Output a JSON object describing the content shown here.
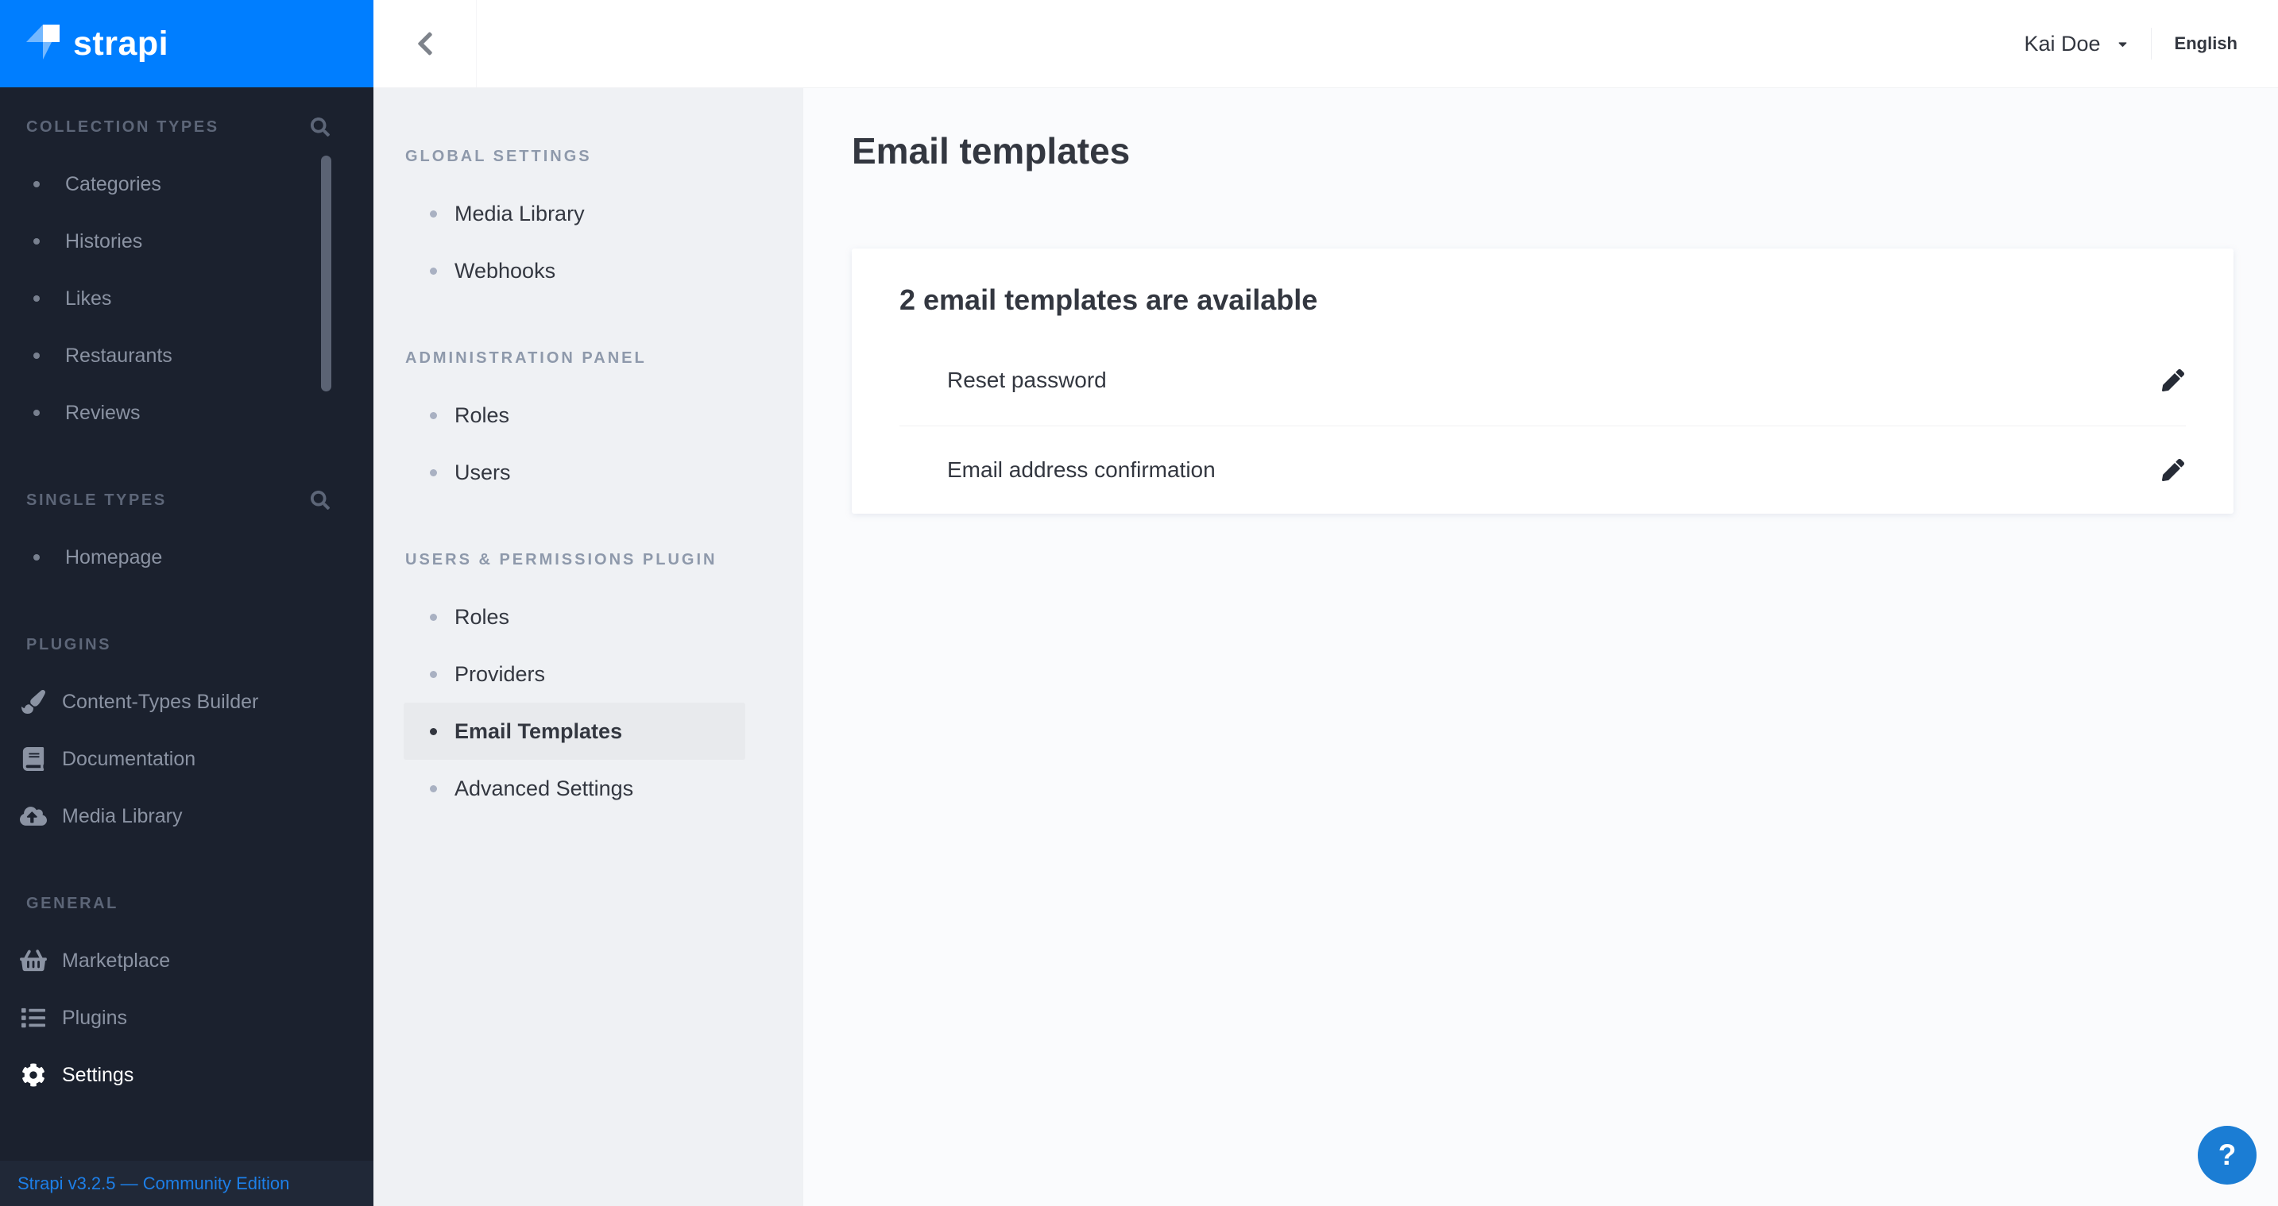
{
  "brand": {
    "name": "strapi",
    "accent_color": "#007eff",
    "sidebar_color": "#1b212e",
    "help_button_color": "#1b7dd4"
  },
  "topbar": {
    "user_name": "Kai Doe",
    "language": "English"
  },
  "leftnav": {
    "sections": [
      {
        "title": "COLLECTION TYPES",
        "search_icon": "search-icon",
        "items": [
          {
            "label": "Categories"
          },
          {
            "label": "Histories"
          },
          {
            "label": "Likes"
          },
          {
            "label": "Restaurants"
          },
          {
            "label": "Reviews"
          }
        ]
      },
      {
        "title": "SINGLE TYPES",
        "search_icon": "search-icon",
        "items": [
          {
            "label": "Homepage"
          }
        ]
      },
      {
        "title": "PLUGINS",
        "items": [
          {
            "label": "Content-Types Builder",
            "icon": "paint-brush-icon"
          },
          {
            "label": "Documentation",
            "icon": "book-icon"
          },
          {
            "label": "Media Library",
            "icon": "cloud-upload-icon"
          }
        ]
      },
      {
        "title": "GENERAL",
        "items": [
          {
            "label": "Marketplace",
            "icon": "shopping-basket-icon"
          },
          {
            "label": "Plugins",
            "icon": "list-icon"
          },
          {
            "label": "Settings",
            "icon": "gear-icon",
            "active": true
          }
        ]
      }
    ],
    "footer": {
      "version_label": "Strapi v3.2.5 — Community Edition"
    }
  },
  "settings_nav": {
    "sections": [
      {
        "title": "GLOBAL SETTINGS",
        "items": [
          {
            "label": "Media Library"
          },
          {
            "label": "Webhooks"
          }
        ]
      },
      {
        "title": "ADMINISTRATION PANEL",
        "items": [
          {
            "label": "Roles"
          },
          {
            "label": "Users"
          }
        ]
      },
      {
        "title": "USERS & PERMISSIONS PLUGIN",
        "items": [
          {
            "label": "Roles"
          },
          {
            "label": "Providers"
          },
          {
            "label": "Email Templates",
            "active": true
          },
          {
            "label": "Advanced Settings"
          }
        ]
      }
    ]
  },
  "main": {
    "page_title": "Email templates",
    "card": {
      "title": "2 email templates are available",
      "templates": [
        {
          "name": "Reset password",
          "action_icon": "pencil-icon"
        },
        {
          "name": "Email address confirmation",
          "action_icon": "pencil-icon"
        }
      ]
    }
  },
  "help_button": {
    "label": "?"
  }
}
